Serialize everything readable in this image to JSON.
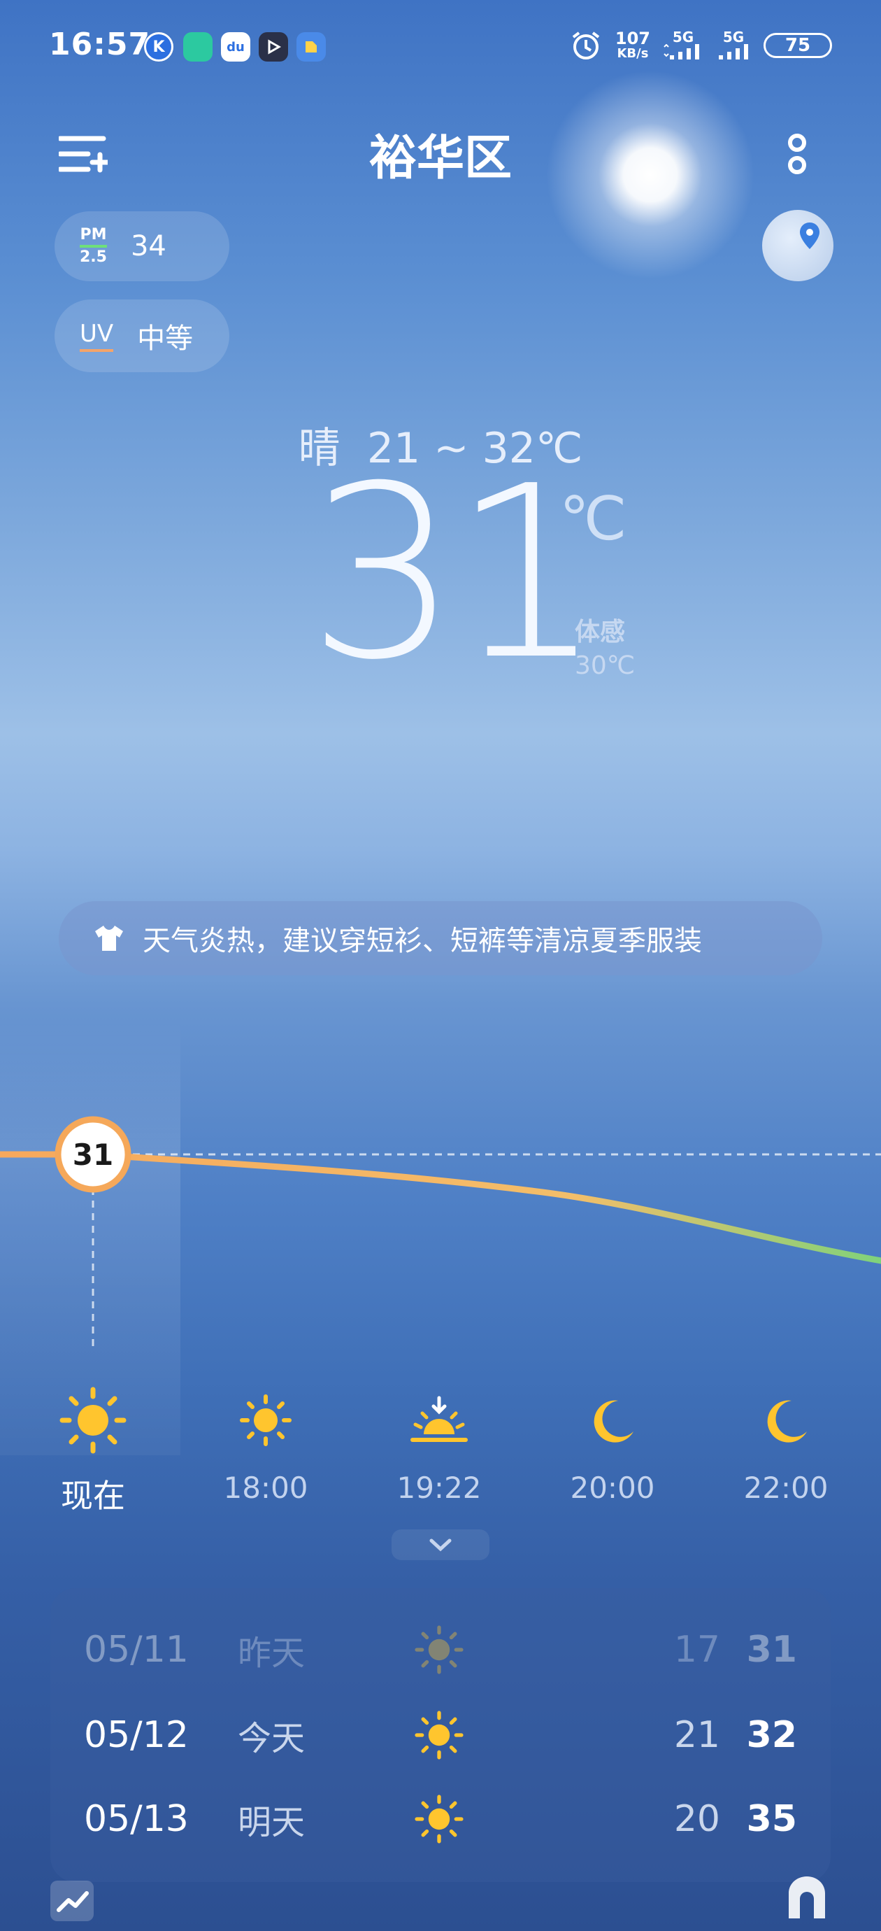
{
  "status_bar": {
    "time": "16:57",
    "apps": [
      "K",
      "shield",
      "du",
      "play",
      "files"
    ],
    "net_speed": "107",
    "net_unit": "KB/s",
    "sig1": "5G",
    "sig2": "5G",
    "battery": "75"
  },
  "header": {
    "city": "裕华区"
  },
  "air": {
    "pm_label_top": "PM",
    "pm_label_bottom": "2.5",
    "pm_value": "34",
    "uv_label": "UV",
    "uv_value": "中等"
  },
  "current": {
    "condition": "晴",
    "range": "21 ~ 32℃",
    "temp": "31",
    "unit": "℃",
    "feels_label": "体感",
    "feels_value": "30℃"
  },
  "advice": "天气炎热，建议穿短衫、短裤等清凉夏季服装",
  "hourly": [
    {
      "time": "现在",
      "icon": "sun-icon",
      "temp": "31"
    },
    {
      "time": "18:00",
      "icon": "sun-icon"
    },
    {
      "time": "19:22",
      "icon": "sunset-icon"
    },
    {
      "time": "20:00",
      "icon": "moon-icon"
    },
    {
      "time": "22:00",
      "icon": "moon-icon"
    }
  ],
  "daily": [
    {
      "date": "05/11",
      "day": "昨天",
      "icon": "sun-icon",
      "low": "17",
      "high": "31"
    },
    {
      "date": "05/12",
      "day": "今天",
      "icon": "sun-icon",
      "low": "21",
      "high": "32"
    },
    {
      "date": "05/13",
      "day": "明天",
      "icon": "sun-icon",
      "low": "20",
      "high": "35"
    }
  ],
  "colors": {
    "accent": "#f5a85a",
    "sun": "#ffc52e",
    "curve_end": "#7fd27a"
  }
}
